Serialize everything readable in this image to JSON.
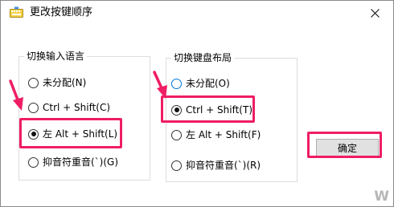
{
  "window": {
    "title": "更改按键顺序"
  },
  "left_group": {
    "legend": "切换输入语言",
    "options": [
      {
        "label": "未分配(N)",
        "checked": false
      },
      {
        "label": "Ctrl + Shift(C)",
        "checked": false
      },
      {
        "label": "左 Alt + Shift(L)",
        "checked": true
      },
      {
        "label": "抑音符重音(`)(G)",
        "checked": false
      }
    ]
  },
  "right_group": {
    "legend": "切换键盘布局",
    "options": [
      {
        "label": "未分配(O)",
        "checked": false
      },
      {
        "label": "Ctrl + Shift(T)",
        "checked": true
      },
      {
        "label": "左 Alt + Shift(F)",
        "checked": false
      },
      {
        "label": "抑音符重音(`)(R)",
        "checked": false
      }
    ]
  },
  "buttons": {
    "ok_label": "确定"
  },
  "watermark": "W",
  "colors": {
    "highlight": "#ef1d64",
    "focus": "#0078d7"
  },
  "icons": {
    "app": "keyboard-icon",
    "close": "close-icon",
    "arrow": "arrow-pointer-icon"
  }
}
